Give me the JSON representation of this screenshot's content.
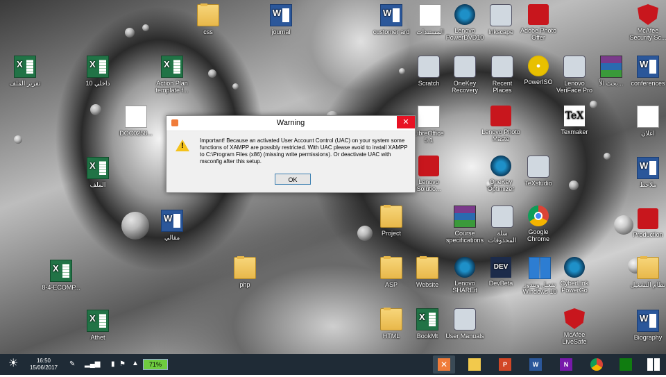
{
  "desktop": {
    "icons": [
      {
        "label": "css",
        "type": "folder"
      },
      {
        "label": "journal",
        "type": "word"
      },
      {
        "label": "customer ard",
        "type": "word"
      },
      {
        "label": "المستندات",
        "type": "page"
      },
      {
        "label": "Lenovo PowerDVD10",
        "type": "generic"
      },
      {
        "label": "Inkscape",
        "type": "generic"
      },
      {
        "label": "Adobe Photo Offer",
        "type": "red"
      },
      {
        "label": "McAfee Security Sc...",
        "type": "mcafee"
      },
      {
        "label": "تقرير الملف",
        "type": "excel"
      },
      {
        "label": "داخلي 10",
        "type": "excel"
      },
      {
        "label": "Action Plan template f...",
        "type": "excel"
      },
      {
        "label": "Scratch",
        "type": "generic"
      },
      {
        "label": "OneKey Recovery",
        "type": "generic"
      },
      {
        "label": "Recent Places",
        "type": "generic"
      },
      {
        "label": "PowerISO",
        "type": "disc"
      },
      {
        "label": "Lenovo VeriFace Pro",
        "type": "generic"
      },
      {
        "label": "بحث الأ...",
        "type": "rar"
      },
      {
        "label": "conferences",
        "type": "word"
      },
      {
        "label": "DOC0258...",
        "type": "page"
      },
      {
        "label": "LibreOffice 5.1",
        "type": "page"
      },
      {
        "label": "Lenovo Photo Maste",
        "type": "red"
      },
      {
        "label": "Texmaker",
        "type": "tex"
      },
      {
        "label": "اعلان",
        "type": "page"
      },
      {
        "label": "الملف",
        "type": "excel"
      },
      {
        "label": "Lenovo Solutio...",
        "type": "red"
      },
      {
        "label": "OneKey Optimizer",
        "type": "round"
      },
      {
        "label": "TeXstudio",
        "type": "generic"
      },
      {
        "label": "ملاحظ",
        "type": "word"
      },
      {
        "label": "مقالي",
        "type": "word"
      },
      {
        "label": "Project",
        "type": "folder"
      },
      {
        "label": "Course specifications",
        "type": "rar"
      },
      {
        "label": "سلة المحذوفات",
        "type": "generic"
      },
      {
        "label": "Google Chrome",
        "type": "chrome"
      },
      {
        "label": "Production",
        "type": "red"
      },
      {
        "label": "8-4-ECOMP...",
        "type": "excel"
      },
      {
        "label": "php",
        "type": "folder"
      },
      {
        "label": "ASP",
        "type": "folder"
      },
      {
        "label": "Website",
        "type": "folder"
      },
      {
        "label": "Lenovo SHAREit",
        "type": "round"
      },
      {
        "label": "DevBeta",
        "type": "dev"
      },
      {
        "label": "تفعيل ويندوز Windows 10",
        "type": "win"
      },
      {
        "label": "CyberLink PowerGo",
        "type": "round"
      },
      {
        "label": "نظام التشغيل",
        "type": "folder"
      },
      {
        "label": "Athet",
        "type": "excel"
      },
      {
        "label": "HTML",
        "type": "folder"
      },
      {
        "label": "BookMt",
        "type": "excel"
      },
      {
        "label": "User Manuals",
        "type": "generic"
      },
      {
        "label": "McAfee LiveSafe",
        "type": "mcafee"
      },
      {
        "label": "Biography",
        "type": "word"
      }
    ]
  },
  "dialog": {
    "title": "Warning",
    "close_glyph": "✕",
    "message": "Important! Because an activated User Account Control (UAC) on your system some functions of XAMPP are possibly restricted. With UAC please avoid to install XAMPP to C:\\Program Files (x86) (missing write permissions). Or deactivate UAC with msconfig after this setup.",
    "ok_label": "OK"
  },
  "taskbar": {
    "clock_time": "16:50",
    "clock_date": "15/06/2017",
    "battery": "71%",
    "tray_chevron": "▲",
    "apps": [
      {
        "name": "xampp",
        "color": "#f07c3a",
        "glyph": "✕"
      },
      {
        "name": "file-explorer",
        "color": "#f2c94c",
        "glyph": ""
      },
      {
        "name": "powerpoint",
        "color": "#d24726",
        "glyph": "P"
      },
      {
        "name": "word",
        "color": "#2b579a",
        "glyph": "W"
      },
      {
        "name": "onenote",
        "color": "#7719aa",
        "glyph": "N"
      },
      {
        "name": "chrome",
        "color": "#db4437",
        "glyph": ""
      },
      {
        "name": "store",
        "color": "#107c10",
        "glyph": ""
      },
      {
        "name": "windows",
        "color": "#ffffff",
        "glyph": ""
      }
    ]
  }
}
